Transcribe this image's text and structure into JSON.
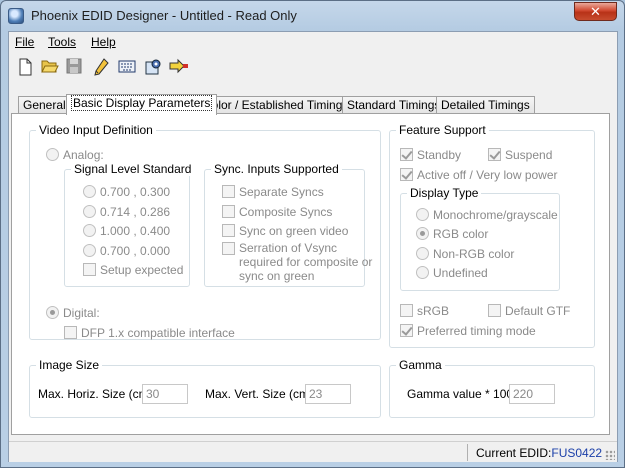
{
  "window": {
    "title": "Phoenix EDID Designer - Untitled - Read Only",
    "close_label": "✕"
  },
  "menu": {
    "file": "File",
    "tools": "Tools",
    "help": "Help"
  },
  "toolbar": {
    "buttons": [
      "new-icon",
      "open-folder-icon",
      "save-icon",
      "pencil-icon",
      "keyboard-icon",
      "settings-gear-icon",
      "arrow-export-icon"
    ]
  },
  "tabs": [
    "General",
    "Basic Display Parameters",
    "Color /  Established Timings",
    "Standard Timings",
    "Detailed Timings"
  ],
  "video_input": {
    "title": "Video Input Definition",
    "analog_label": "Analog:",
    "signal_level": {
      "title": "Signal Level Standard",
      "options": [
        "0.700 , 0.300",
        "0.714 , 0.286",
        "1.000 , 0.400",
        "0.700 , 0.000"
      ],
      "setup_expected": "Setup expected"
    },
    "sync": {
      "title": "Sync. Inputs Supported",
      "separate": "Separate Syncs",
      "composite": "Composite Syncs",
      "sync_green": "Sync on green video",
      "serration_1": "Serration of Vsync",
      "serration_2": "required for composite or",
      "serration_3": "sync on green"
    },
    "digital_label": "Digital:",
    "dfp_label": "DFP 1.x compatible interface"
  },
  "feature_support": {
    "title": "Feature Support",
    "standby": "Standby",
    "suspend": "Suspend",
    "active_off": "Active off / Very low power",
    "display_type": {
      "title": "Display Type",
      "options": [
        "Monochrome/grayscale",
        "RGB color",
        "Non-RGB color",
        "Undefined"
      ],
      "selected": "RGB color"
    },
    "srgb": "sRGB",
    "default_gtf": "Default GTF",
    "preferred_timing": "Preferred timing mode"
  },
  "image_size": {
    "title": "Image Size",
    "horiz_label": "Max. Horiz. Size (cm):",
    "horiz_value": "30",
    "vert_label": "Max. Vert. Size (cm):",
    "vert_value": "23"
  },
  "gamma": {
    "title": "Gamma",
    "label": "Gamma value * 100:",
    "value": "220"
  },
  "status": {
    "label": "Current EDID:",
    "value": "FUS0422"
  }
}
